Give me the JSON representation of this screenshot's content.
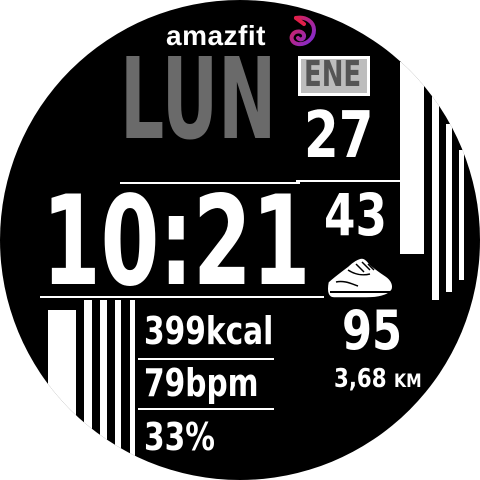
{
  "brand": {
    "name": "amazfit",
    "logo_icon": "amazfit-logo-icon"
  },
  "date": {
    "weekday": "LUN",
    "month": "ENE",
    "day": "27"
  },
  "time": {
    "hours_minutes": "10:21",
    "seconds": "43"
  },
  "activity": {
    "steps": "95",
    "distance_value": "3,68",
    "distance_unit": "KM",
    "steps_icon": "sneaker-icon"
  },
  "stats": {
    "calories": "399kcal",
    "heart_rate": "79bpm",
    "battery": "33%"
  },
  "colors": {
    "background": "#000000",
    "foreground": "#ffffff",
    "weekday_gray": "#6a6a6a",
    "month_box": "#bdbdbd",
    "logo_red": "#e0204a",
    "logo_purple": "#7b2bd9"
  }
}
